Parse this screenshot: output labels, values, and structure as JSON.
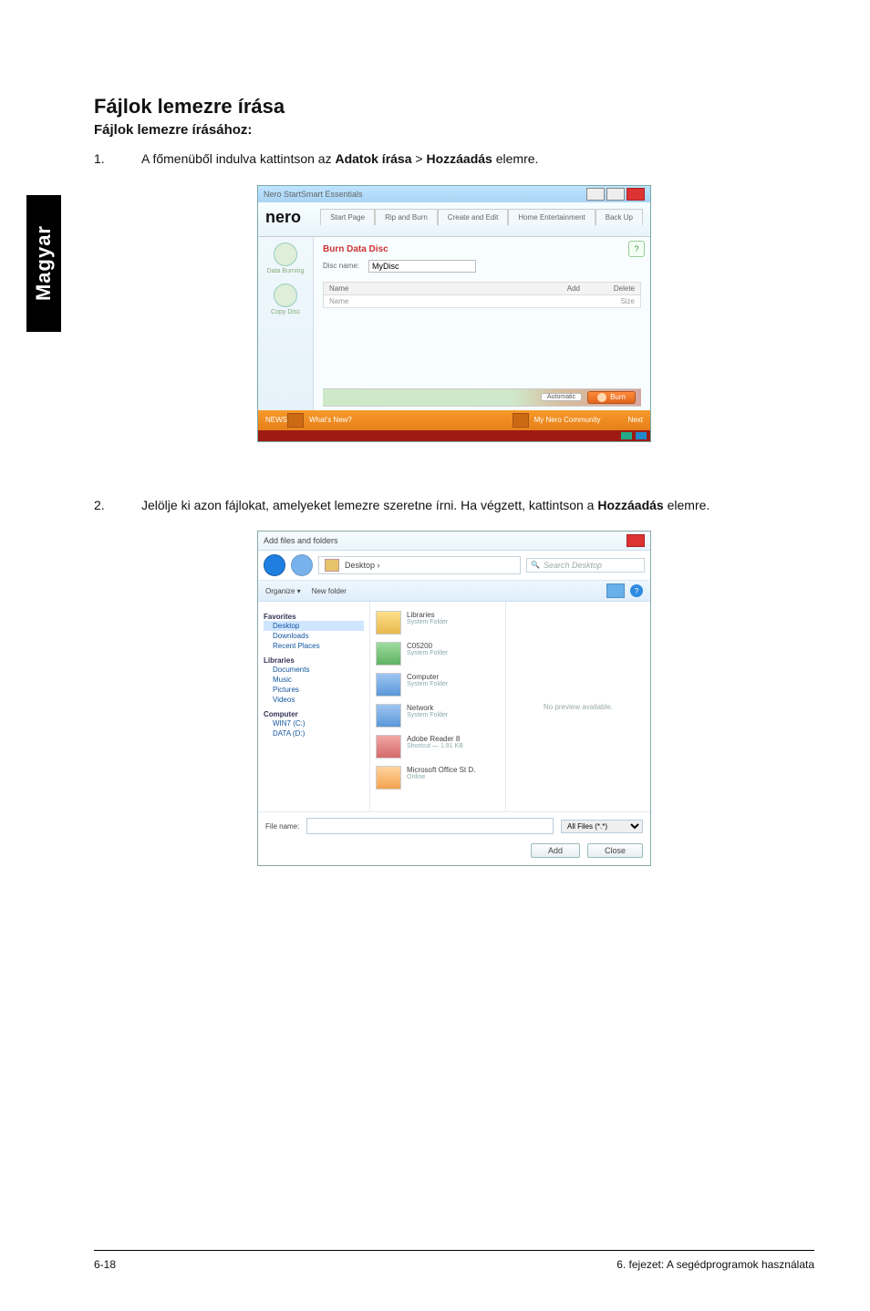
{
  "side_tab": "Magyar",
  "h1": "Fájlok lemezre írása",
  "h2": "Fájlok lemezre írásához:",
  "step1": {
    "num": "1.",
    "pre": "A főmenüből indulva kattintson az ",
    "b1": "Adatok írása",
    "mid": " > ",
    "b2": "Hozzáadás",
    "post": " elemre."
  },
  "step2": {
    "num": "2.",
    "pre": "Jelölje ki azon fájlokat, amelyeket lemezre szeretne írni. Ha végzett, kattintson a ",
    "b1": "Hozzáadás",
    "post": " elemre."
  },
  "fig1": {
    "title": "Nero StartSmart Essentials",
    "logo": "nero",
    "tabs": [
      "Start Page",
      "Rip and Burn",
      "Create and Edit",
      "Home Entertainment",
      "Back Up"
    ],
    "side": [
      {
        "label": "Data Burning"
      },
      {
        "label": "Copy Disc"
      }
    ],
    "help_icon": "?",
    "bdd": "Burn Data Disc",
    "dn_label": "Disc name:",
    "dn_value": "MyDisc",
    "cols": {
      "name": "Name",
      "blank": "",
      "add": "Add",
      "delete": "Delete"
    },
    "row": {
      "name": "Name",
      "size": "Size"
    },
    "gauge": {
      "mode": "Automatic"
    },
    "burn": "Burn",
    "news_label": "NEWS",
    "news_left": "What's New?",
    "news_right": "My Nero Community",
    "news_next": "Next"
  },
  "fig2": {
    "title": "Add files and folders",
    "crumb": "Desktop  ›",
    "search_ph": "Search Desktop",
    "tool_org": "Organize ▾",
    "tool_new": "New folder",
    "help_icon": "?",
    "nav": {
      "fav": "Favorites",
      "fav_items": [
        "Desktop",
        "Downloads",
        "Recent Places"
      ],
      "lib": "Libraries",
      "lib_items": [
        "Documents",
        "Music",
        "Pictures",
        "Videos"
      ],
      "comp": "Computer",
      "comp_items": [
        "WIN7 (C:)",
        "DATA (D:)"
      ]
    },
    "tiles": [
      {
        "t": "Libraries",
        "s": "System Folder",
        "c": "y"
      },
      {
        "t": "C05200",
        "s": "System Folder",
        "c": "g"
      },
      {
        "t": "Computer",
        "s": "System Folder",
        "c": "b"
      },
      {
        "t": "Network",
        "s": "System Folder",
        "c": "b"
      },
      {
        "t": "Adobe Reader 8",
        "s": "Shortcut — 1.91 KB",
        "c": "r"
      },
      {
        "t": "Microsoft Office St D.",
        "s": "Online",
        "c": "o"
      }
    ],
    "preview": "No preview available.",
    "fn_label": "File name:",
    "filter": "All Files (*.*)",
    "btn_add": "Add",
    "btn_close": "Close"
  },
  "footer": {
    "left": "6-18",
    "right": "6. fejezet: A segédprogramok használata"
  }
}
